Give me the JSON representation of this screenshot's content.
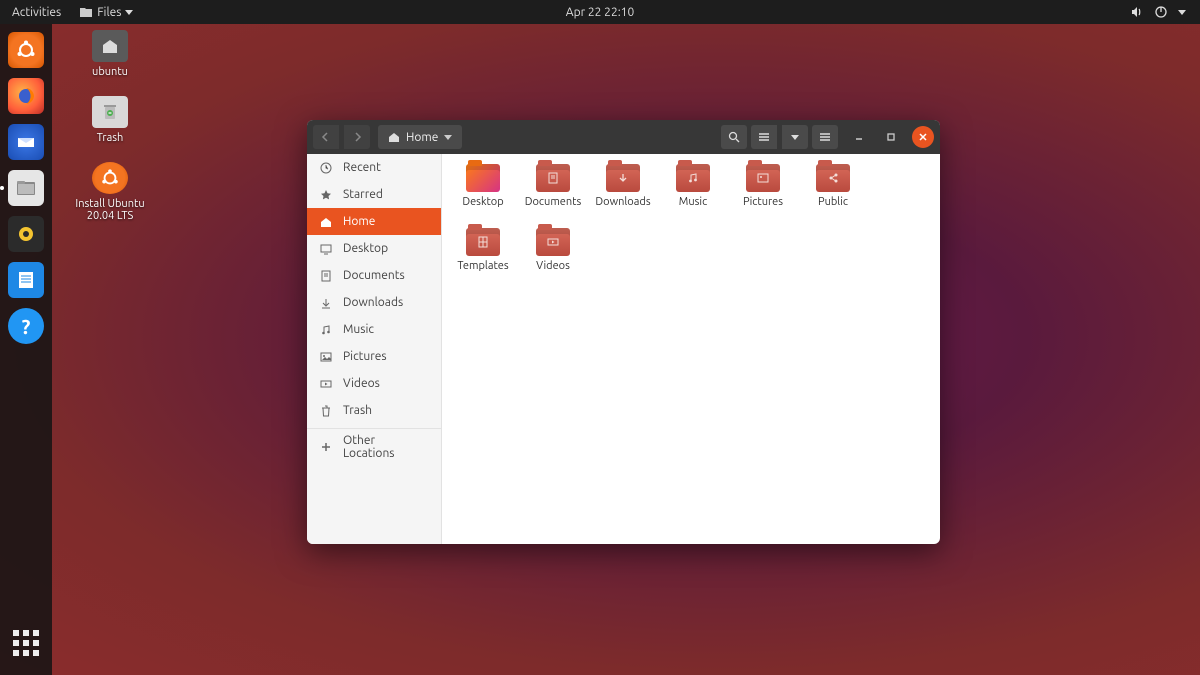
{
  "topbar": {
    "activities": "Activities",
    "appmenu": "Files",
    "datetime": "Apr 22  22:10"
  },
  "desktop_icons": [
    {
      "id": "home-folder",
      "label": "ubuntu"
    },
    {
      "id": "trash",
      "label": "Trash"
    },
    {
      "id": "installer",
      "label": "Install Ubuntu 20.04 LTS"
    }
  ],
  "files_window": {
    "path_label": "Home",
    "sidebar": [
      {
        "id": "recent",
        "label": "Recent",
        "icon": "clock-icon"
      },
      {
        "id": "starred",
        "label": "Starred",
        "icon": "star-icon"
      },
      {
        "id": "home",
        "label": "Home",
        "icon": "home-icon",
        "active": true
      },
      {
        "id": "desktop",
        "label": "Desktop",
        "icon": "desktop-icon"
      },
      {
        "id": "documents",
        "label": "Documents",
        "icon": "documents-icon"
      },
      {
        "id": "downloads",
        "label": "Downloads",
        "icon": "downloads-icon"
      },
      {
        "id": "music",
        "label": "Music",
        "icon": "music-icon"
      },
      {
        "id": "pictures",
        "label": "Pictures",
        "icon": "pictures-icon"
      },
      {
        "id": "videos",
        "label": "Videos",
        "icon": "videos-icon"
      },
      {
        "id": "trash",
        "label": "Trash",
        "icon": "trash-icon"
      },
      {
        "id": "other",
        "label": "Other Locations",
        "icon": "plus-icon",
        "separated": true
      }
    ],
    "folders": [
      {
        "label": "Desktop",
        "icon": "desktop"
      },
      {
        "label": "Documents",
        "icon": "documents"
      },
      {
        "label": "Downloads",
        "icon": "downloads"
      },
      {
        "label": "Music",
        "icon": "music"
      },
      {
        "label": "Pictures",
        "icon": "pictures"
      },
      {
        "label": "Public",
        "icon": "public"
      },
      {
        "label": "Templates",
        "icon": "templates"
      },
      {
        "label": "Videos",
        "icon": "videos"
      }
    ]
  }
}
